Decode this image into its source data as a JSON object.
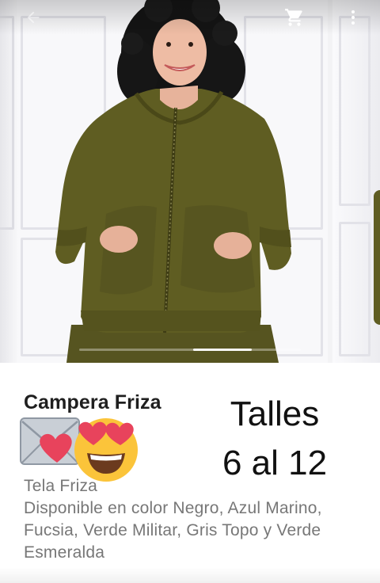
{
  "topbar": {
    "back_icon": "arrow-back-icon",
    "cart_icon": "shopping-cart-icon",
    "more_icon": "more-vert-icon"
  },
  "gallery": {
    "active_slide": 2,
    "indicator_color": "#ffffff"
  },
  "product": {
    "title": "Campera Friza",
    "sizes_line1": "Talles",
    "sizes_line2": "6 al 12",
    "description_line1": "Tela Friza",
    "description_line2": "Disponible en color Negro, Azul Marino,",
    "description_line3": "Fucsia, Verde Militar, Gris Topo y Verde",
    "description_line4": "Esmeralda",
    "emojis": [
      "love-letter-icon",
      "heart-eyes-emoji-icon"
    ]
  },
  "colors": {
    "jacket": "#5f5d22",
    "text_title": "#1f1f1f",
    "text_desc": "#777777"
  }
}
